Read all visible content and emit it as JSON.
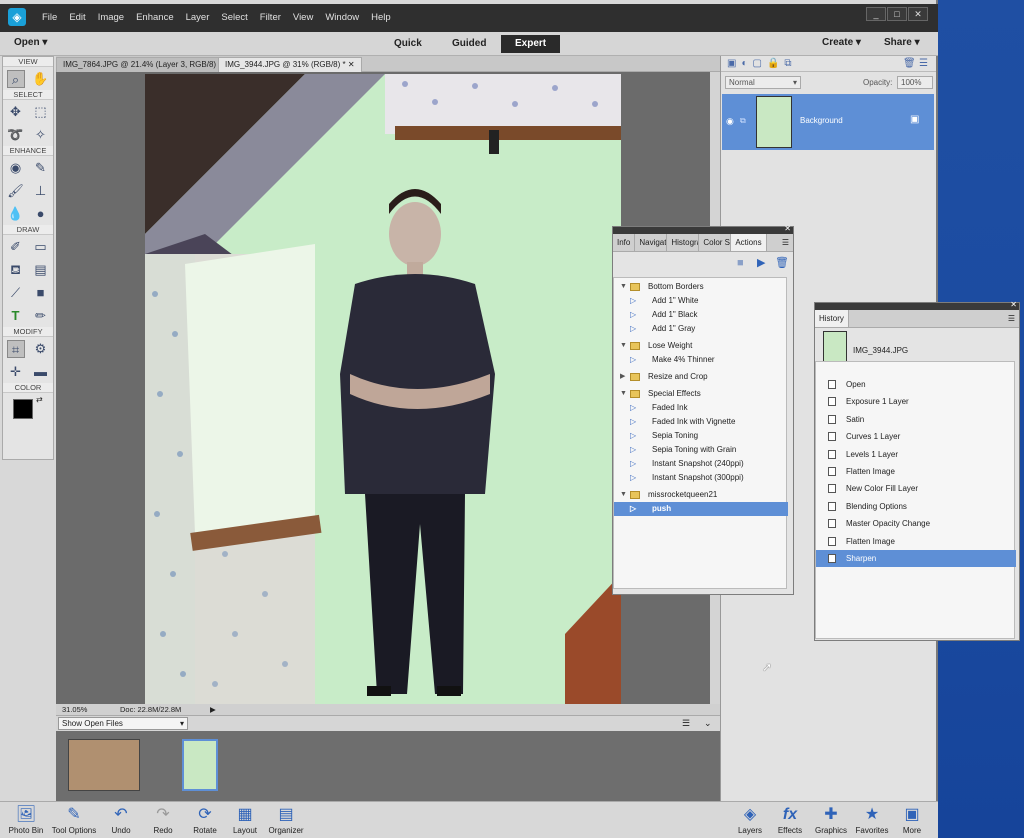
{
  "app": {
    "menu": [
      "File",
      "Edit",
      "Image",
      "Enhance",
      "Layer",
      "Select",
      "Filter",
      "View",
      "Window",
      "Help"
    ],
    "window_controls": [
      "_",
      "□",
      "✕"
    ]
  },
  "modebar": {
    "open": "Open",
    "modes": [
      "Quick",
      "Guided",
      "Expert"
    ],
    "create": "Create",
    "share": "Share"
  },
  "doc_tabs": [
    {
      "label": "IMG_7864.JPG @ 21.4% (Layer 3, RGB/8) *"
    },
    {
      "label": "IMG_3944.JPG @ 31% (RGB/8) *"
    }
  ],
  "toolbox": {
    "sections": [
      "VIEW",
      "SELECT",
      "ENHANCE",
      "DRAW",
      "MODIFY",
      "COLOR"
    ]
  },
  "status": {
    "zoom": "31.05%",
    "doc": "Doc: 22.8M/22.8M"
  },
  "bin": {
    "select": "Show Open Files"
  },
  "layers": {
    "blend_mode": "Normal",
    "opacity_label": "Opacity:",
    "opacity_value": "100%",
    "layer_name": "Background"
  },
  "actions_panel": {
    "tabs": [
      "Info",
      "Navigat",
      "Histogra",
      "Color Sv",
      "Actions"
    ],
    "items": [
      {
        "label": "Bottom Borders",
        "kind": "group"
      },
      {
        "label": "Add 1\" White",
        "kind": "action"
      },
      {
        "label": "Add 1\" Black",
        "kind": "action"
      },
      {
        "label": "Add 1\" Gray",
        "kind": "action"
      },
      {
        "label": "Lose Weight",
        "kind": "group"
      },
      {
        "label": "Make 4% Thinner",
        "kind": "action"
      },
      {
        "label": "Resize and Crop",
        "kind": "group"
      },
      {
        "label": "Special Effects",
        "kind": "group"
      },
      {
        "label": "Faded Ink",
        "kind": "action"
      },
      {
        "label": "Faded Ink with Vignette",
        "kind": "action"
      },
      {
        "label": "Sepia Toning",
        "kind": "action"
      },
      {
        "label": "Sepia Toning with Grain",
        "kind": "action"
      },
      {
        "label": "Instant Snapshot (240ppi)",
        "kind": "action"
      },
      {
        "label": "Instant Snapshot (300ppi)",
        "kind": "action"
      },
      {
        "label": "missrocketqueen21",
        "kind": "group"
      },
      {
        "label": "push",
        "kind": "action-selected"
      }
    ]
  },
  "history_panel": {
    "tab": "History",
    "snapshot": "IMG_3944.JPG",
    "items": [
      "Open",
      "Exposure 1 Layer",
      "Satin",
      "Curves 1 Layer",
      "Levels 1 Layer",
      "Flatten Image",
      "New Color Fill Layer",
      "Blending Options",
      "Master Opacity Change",
      "Flatten Image",
      "Sharpen"
    ],
    "selected_index": 10
  },
  "bottombar": {
    "left": [
      "Photo Bin",
      "Tool Options",
      "Undo",
      "Redo",
      "Rotate",
      "Layout",
      "Organizer"
    ],
    "right": [
      "Layers",
      "Effects",
      "Graphics",
      "Favorites",
      "More"
    ]
  },
  "colors": {
    "selection": "#5e8fd6",
    "desktop": "#1d50a8",
    "titlebar": "#2f2f2f"
  }
}
